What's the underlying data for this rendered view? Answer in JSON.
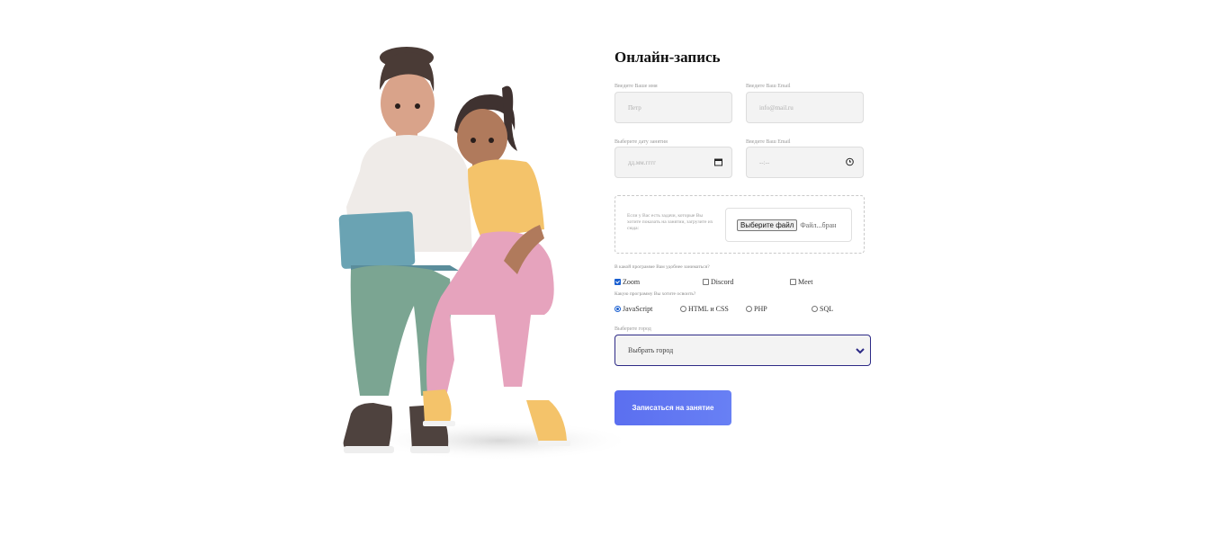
{
  "title": "Онлайн-запись",
  "name_field": {
    "label": "Введите Ваше имя",
    "placeholder": "Петр"
  },
  "email_field": {
    "label": "Введите Ваш Email",
    "placeholder": "info@mail.ru"
  },
  "date_field": {
    "label": "Выберите дату занятия",
    "placeholder": "дд.мм.гггг",
    "icon": "calendar-icon"
  },
  "time_field": {
    "label": "Введите Ваш Email",
    "placeholder": "--:--",
    "icon": "clock-icon"
  },
  "file_upload": {
    "hint": "Если у Вас есть задачи, которые Вы хотите показать на занятии, загрузите их сюда:",
    "button_label": "Выберите файл",
    "status": "Файл...бран"
  },
  "program_question": "В какой программе Вам удобнее заниматься?",
  "programs": [
    {
      "label": "Zoom",
      "checked": true
    },
    {
      "label": "Discord",
      "checked": false
    },
    {
      "label": "Meet",
      "checked": false
    }
  ],
  "course_question": "Какую программу Вы хотите освоить?",
  "courses": [
    {
      "label": "JavaScript",
      "selected": true
    },
    {
      "label": "HTML и CSS",
      "selected": false
    },
    {
      "label": "PHP",
      "selected": false
    },
    {
      "label": "SQL",
      "selected": false
    }
  ],
  "city": {
    "label": "Выберите город",
    "selected": "Выбрать город",
    "icon": "chevron-down-icon"
  },
  "submit_label": "Записаться на занятие",
  "colors": {
    "accent": "#5b6ff0",
    "select_border": "#2d2a86",
    "field_bg": "#f3f3f3"
  }
}
